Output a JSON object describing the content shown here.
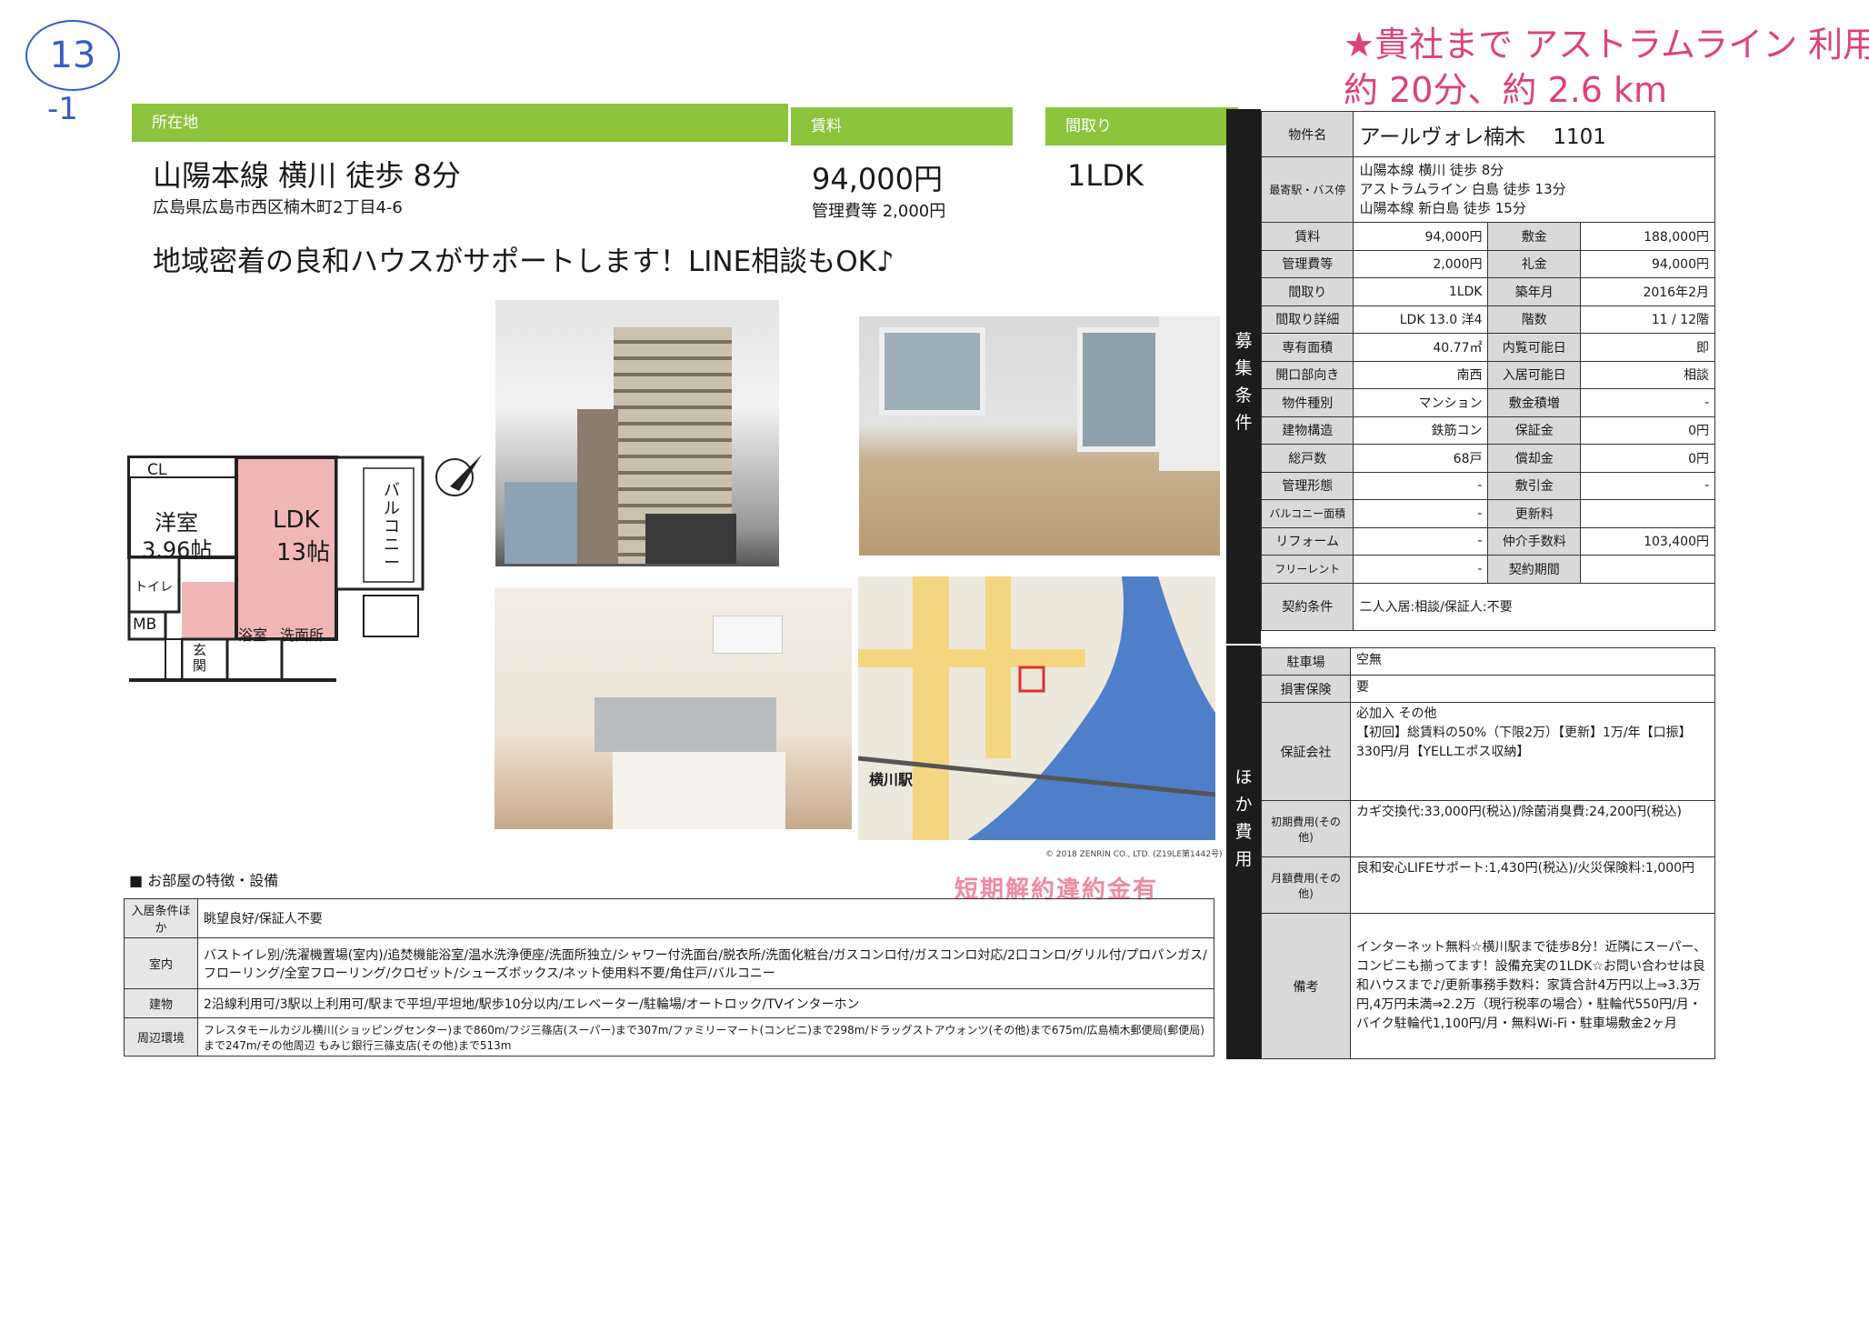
{
  "handwriting": {
    "circle_number": "13",
    "sub_mark": "-1",
    "note_line1": "★貴社まで アストラムライン 利用",
    "note_line2": "約 20分、約 2.6 km"
  },
  "header": {
    "location_label": "所在地",
    "station": "山陽本線 横川 徒歩 8分",
    "address": "広島県広島市西区楠木町2丁目4-6",
    "rent_label": "賃料",
    "rent": "94,000円",
    "mgmt_fee": "管理費等 2,000円",
    "layout_label": "間取り",
    "layout": "1LDK",
    "catchphrase": "地域密着の良和ハウスがサポートします！LINE相談もOK♪"
  },
  "floorplan": {
    "cl": "CL",
    "western_room": "洋室",
    "western_size": "3.96帖",
    "ldk": "LDK",
    "ldk_size": "13帖",
    "balcony": "バルコニー",
    "toilet": "トイレ",
    "mb": "MB",
    "entrance": "玄関",
    "bath": "浴室",
    "washroom": "洗面所"
  },
  "map": {
    "station_label": "横川駅",
    "copyright": "© 2018 ZENRIN CO., LTD. (Z19LE第1442号)"
  },
  "features": {
    "heading": "■ お部屋の特徴・設備",
    "stamp": "短期解約違約金有",
    "rows": [
      {
        "label": "入居条件ほか",
        "value": "眺望良好/保証人不要"
      },
      {
        "label": "室内",
        "value": "バストイレ別/洗濯機置場(室内)/追焚機能浴室/温水洗浄便座/洗面所独立/シャワー付洗面台/脱衣所/洗面化粧台/ガスコンロ付/ガスコンロ対応/2口コンロ/グリル付/プロパンガス/フローリング/全室フローリング/クロゼット/シューズボックス/ネット使用料不要/角住戸/バルコニー"
      },
      {
        "label": "建物",
        "value": "2沿線利用可/3駅以上利用可/駅まで平坦/平坦地/駅歩10分以内/エレベーター/駐輪場/オートロック/TVインターホン"
      },
      {
        "label": "周辺環境",
        "value": "フレスタモールカジル横川(ショッピングセンター)まで860m/フジ三篠店(スーパー)まで307m/ファミリーマート(コンビニ)まで298m/ドラッグストアウォンツ(その他)まで675m/広島楠木郵便局(郵便局)まで247m/その他周辺 もみじ銀行三篠支店(その他)まで513m"
      }
    ]
  },
  "side_bars": {
    "conditions": "募集条件",
    "other_costs": "ほか費用"
  },
  "spec": {
    "name_label": "物件名",
    "name": "アールヴォレ楠木　 1101",
    "access_label": "最寄駅・バス停",
    "access": [
      "山陽本線 横川 徒歩 8分",
      "アストラムライン 白島 徒歩 13分",
      "山陽本線 新白島 徒歩 15分"
    ],
    "rows": [
      [
        "賃料",
        "94,000円",
        "敷金",
        "188,000円"
      ],
      [
        "管理費等",
        "2,000円",
        "礼金",
        "94,000円"
      ],
      [
        "間取り",
        "1LDK",
        "築年月",
        "2016年2月"
      ],
      [
        "間取り詳細",
        "LDK 13.0 洋4",
        "階数",
        "11 / 12階"
      ],
      [
        "専有面積",
        "40.77㎡",
        "内覧可能日",
        "即"
      ],
      [
        "開口部向き",
        "南西",
        "入居可能日",
        "相談"
      ],
      [
        "物件種別",
        "マンション",
        "敷金積増",
        "-"
      ],
      [
        "建物構造",
        "鉄筋コン",
        "保証金",
        "0円"
      ],
      [
        "総戸数",
        "68戸",
        "償却金",
        "0円"
      ],
      [
        "管理形態",
        "-",
        "敷引金",
        "-"
      ],
      [
        "バルコニー面積",
        "-",
        "更新料",
        ""
      ],
      [
        "リフォーム",
        "-",
        "仲介手数料",
        "103,400円"
      ],
      [
        "フリーレント",
        "-",
        "契約期間",
        ""
      ]
    ],
    "contract_label": "契約条件",
    "contract": "二人入居:相談/保証人:不要"
  },
  "other": {
    "rows": [
      {
        "label": "駐車場",
        "value": "空無"
      },
      {
        "label": "損害保険",
        "value": "要"
      },
      {
        "label": "保証会社",
        "value": "必加入 その他\n【初回】総賃料の50%（下限2万）【更新】1万/年【口振】330円/月【YELLエポス収納】"
      },
      {
        "label": "初期費用(その他)",
        "value": "カギ交換代:33,000円(税込)/除菌消臭費:24,200円(税込)"
      },
      {
        "label": "月額費用(その他)",
        "value": "良和安心LIFEサポート:1,430円(税込)/火災保険料:1,000円"
      },
      {
        "label": "備考",
        "value": "インターネット無料☆横川駅まで徒歩8分！近隣にスーパー、コンビニも揃ってます！設備充実の1LDK☆お問い合わせは良和ハウスまで♪/更新事務手数料：家賃合計4万円以上⇒3.3万円,4万円未満⇒2.2万（現行税率の場合）・駐輪代550円/月・バイク駐輪代1,100円/月・無料Wi-Fi・駐車場敷金2ヶ月"
      }
    ]
  }
}
